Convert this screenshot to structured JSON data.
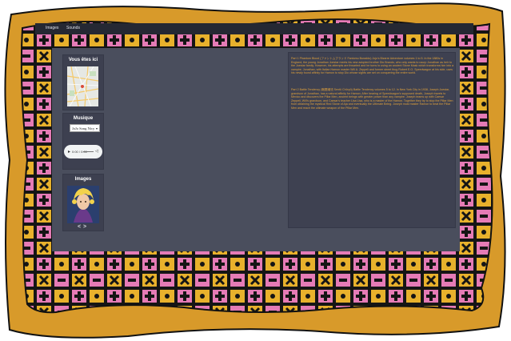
{
  "nav": {
    "links": [
      {
        "label": "Images"
      },
      {
        "label": "Sounds"
      }
    ]
  },
  "widgets": {
    "location": {
      "title": "Vous êtes ici"
    },
    "music": {
      "title": "Musique",
      "selected_track": "JoJo Song Nicy",
      "audio_time": "0:00 / 0:00"
    },
    "images": {
      "title": "Images",
      "prev": "<",
      "next": ">"
    }
  },
  "content": {
    "paragraph1": "Part 1 Phantom Blood (ファントムブラッド Fantomu Buraddo) Jojo's Bizarre Adventure volumes 1 to 5. In the 1880s in England, the young Jonathan Joestar meets his new adopted brother Dio Brando, who only wants to usurp Jonathan as heir to the Joestar family. However, his attempts are thwarted and he turns to using an ancient Stone Mask which transforms him into a vampire. Jonathan, with Italian Hamon master Will A. Zeppeli and former street thug Robert E.O. Speedwagon at his side, uses his newly found affinity for Hamon to stop Dio whose sights are set on conquering the entire world.",
    "paragraph2": "Part 2 Battle Tendency (戦闘潮流 Sentō Chōryū) Battle Tendency volumes 5 to 12. In New York City in 1938, Joseph Joestar, grandson of Jonathan, has a natural affinity for Hamon. After hearing of Speedwagon's supposed death, Joseph travels to Mexico and discovers the Pillar Men, ancient beings with greater power than any vampire. Joseph teams up with Caesar Zeppeli, Will's grandson, and Caesar's teacher Lisa Lisa, who is a master of the Hamon. Together they try to stop the Pillar Men from obtaining the mystical Red Stone of Aja and eventually the Ultimate Being. Joseph must master Hamon to beat the Pillar Men and reach the ultimate weapon of the Pillar Men."
  },
  "colors": {
    "frame": "#d89a2a",
    "pattern_bg": "#1a1a1a",
    "pattern_pink": "#e57bb6",
    "pattern_yellow": "#e8b12c",
    "panel": "#4a4e5d",
    "navbar": "#252833",
    "paragraph_text": "#e0a13c"
  }
}
